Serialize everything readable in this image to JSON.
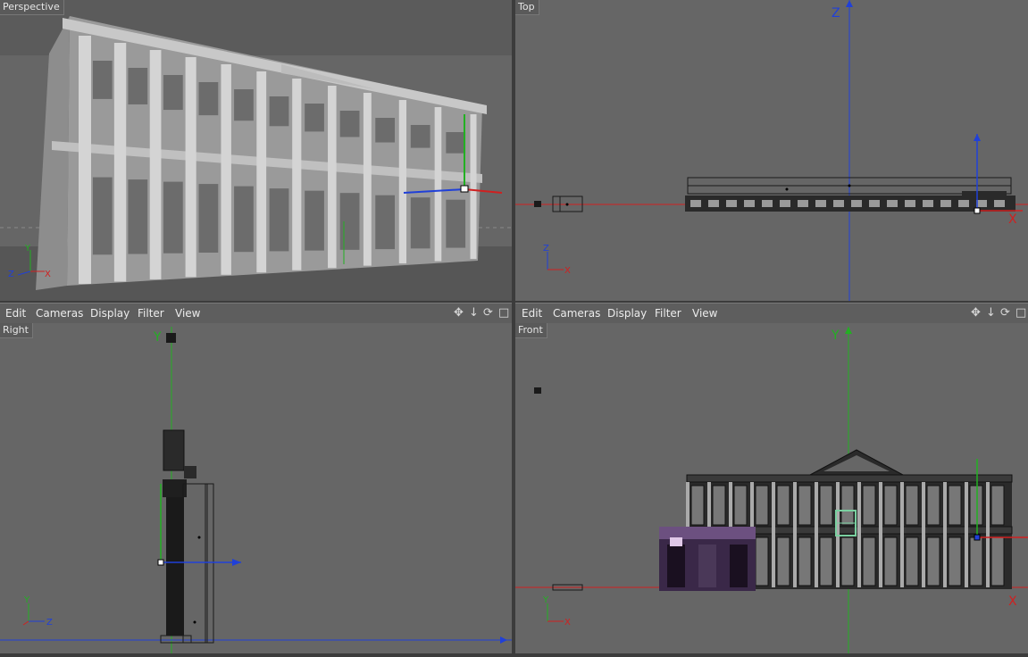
{
  "viewports": {
    "perspective": {
      "label": "Perspective"
    },
    "top": {
      "label": "Top",
      "axis_v": "Z",
      "axis_h": "X",
      "gizmo_v": "Z",
      "gizmo_h": "X"
    },
    "right": {
      "label": "Right",
      "axis_v": "Y",
      "axis_h": "Z",
      "gizmo_v": "Y",
      "gizmo_h": "Z"
    },
    "front": {
      "label": "Front",
      "axis_v": "Y",
      "axis_h": "X",
      "gizmo_v": "Y",
      "gizmo_h": "X"
    }
  },
  "menu": {
    "edit": "Edit",
    "cameras": "Cameras",
    "display": "Display",
    "filter": "Filter",
    "view": "View"
  },
  "nav_icons": [
    "move-icon",
    "zoom-icon",
    "rotate-icon",
    "maximize-icon"
  ],
  "colors": {
    "viewport_bg": "#666666",
    "axis_x": "#d02020",
    "axis_y": "#22b022",
    "axis_z": "#2040d8",
    "model": "#2a2a2a"
  }
}
